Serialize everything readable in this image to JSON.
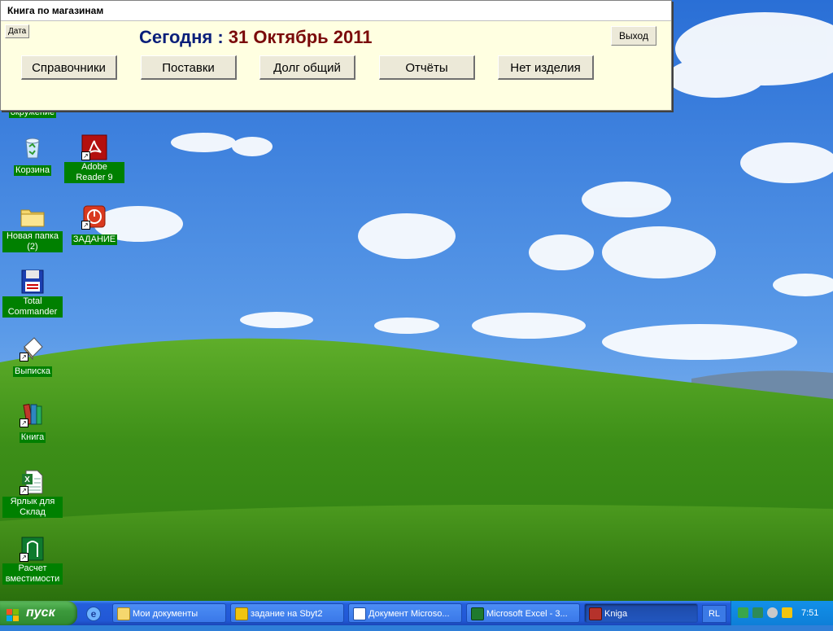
{
  "app": {
    "title": "Книга по магазинам",
    "date_button": "Дата",
    "today_label": "Сегодня",
    "today_colon": " : ",
    "today_date": "31 Октябрь 2011",
    "exit_button": "Выход",
    "nav": [
      {
        "label": "Справочники"
      },
      {
        "label": "Поставки"
      },
      {
        "label": "Долг общий"
      },
      {
        "label": "Отчёты"
      },
      {
        "label": "Нет изделия"
      }
    ]
  },
  "desktop": {
    "icons": [
      {
        "label": "окружение",
        "icon": "network-icon"
      },
      {
        "label": "Корзина",
        "icon": "recycle-bin-icon"
      },
      {
        "label": "Adobe Reader 9",
        "icon": "adobe-reader-icon"
      },
      {
        "label": "Новая папка (2)",
        "icon": "folder-icon"
      },
      {
        "label": "ЗАДАНИЕ",
        "icon": "task-app-icon"
      },
      {
        "label": "Total Commander",
        "icon": "total-commander-icon"
      },
      {
        "label": "Выписка",
        "icon": "document-icon"
      },
      {
        "label": "Книга",
        "icon": "books-icon"
      },
      {
        "label": "Ярлык для Склад",
        "icon": "excel-file-icon"
      },
      {
        "label": "Расчет вместимости",
        "icon": "calc-icon"
      }
    ]
  },
  "taskbar": {
    "start_label": "пуск",
    "tasks": [
      {
        "label": "Мои документы",
        "icon": "folder-icon"
      },
      {
        "label": "задание на Sbyt2",
        "icon": "task-icon"
      },
      {
        "label": "Документ Microso...",
        "icon": "word-icon"
      },
      {
        "label": "Microsoft Excel - 3...",
        "icon": "excel-icon"
      },
      {
        "label": "Kniga",
        "icon": "access-icon"
      }
    ],
    "language": "RL",
    "clock": "7:51"
  },
  "colors": {
    "app_background": "#ffffe1",
    "today_label_color": "#0a1f7a",
    "today_date_color": "#7a0a0a",
    "icon_label_bg": "#008000",
    "taskbar_blue": "#245edb",
    "start_green": "#3c9a3c"
  }
}
